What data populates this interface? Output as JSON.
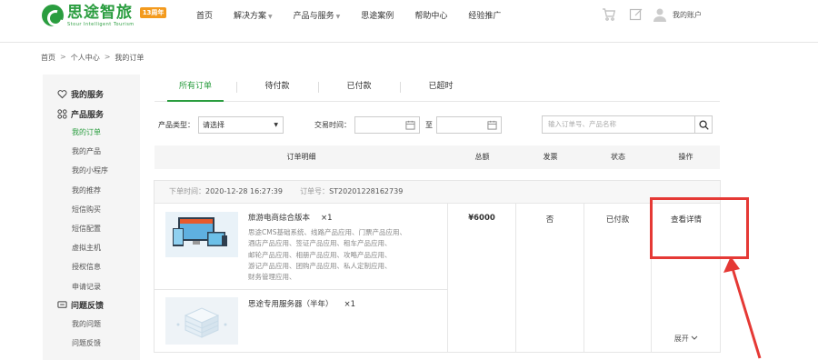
{
  "header": {
    "logo_cn": "思途智旅",
    "logo_en": "Stour  Intelligent  Tourism",
    "logo_badge": "13周年",
    "nav": [
      {
        "label": "首页"
      },
      {
        "label": "解决方案",
        "caret": "▼"
      },
      {
        "label": "产品与服务",
        "caret": "▼"
      },
      {
        "label": "思途案例"
      },
      {
        "label": "帮助中心"
      },
      {
        "label": "经验推广"
      }
    ],
    "icons": [
      "cart-icon",
      "edit-icon",
      "user-icon"
    ],
    "account_label": "我的账户"
  },
  "breadcrumb": [
    "首页",
    "个人中心",
    "我的订单"
  ],
  "breadcrumb_sep": ">",
  "sidebar": {
    "groups": [
      {
        "label": "我的服务",
        "icon": "heart-icon",
        "items": []
      },
      {
        "label": "产品服务",
        "icon": "grid-icon",
        "items": [
          "我的订单",
          "我的产品",
          "我的小程序",
          "我的推荐",
          "短信购买",
          "短信配置",
          "虚拟主机",
          "授权信息",
          "申请记录"
        ]
      },
      {
        "label": "问题反馈",
        "icon": "message-icon",
        "items": [
          "我的问题",
          "问题反馈"
        ]
      }
    ],
    "active_item": "我的订单"
  },
  "tabs": [
    "所有订单",
    "待付款",
    "已付款",
    "已超时"
  ],
  "active_tab": "所有订单",
  "filter": {
    "type_label": "产品类型：",
    "type_value": "请选择",
    "time_label": "交易时间：",
    "to_label": "至",
    "search_placeholder": "输入订单号、产品名称"
  },
  "table_headers": [
    "订单明细",
    "总额",
    "发票",
    "状态",
    "操作"
  ],
  "order": {
    "time_label": "下单时间：",
    "time_value": "2020-12-28 16:27:39",
    "no_label": "订单号：",
    "no_value": "ST20201228162739",
    "products": [
      {
        "name": "旅游电商综合版本",
        "qty": "×1",
        "desc": [
          "思途CMS基础系统、线路产品应用、门票产品应用、",
          "酒店产品应用、签证产品应用、租车产品应用、",
          "邮轮产品应用、相册产品应用、攻略产品应用、",
          "游记产品应用、团购产品应用、私人定制应用、",
          "财务管理应用、"
        ]
      },
      {
        "name": "思途专用服务器（半年）",
        "qty": "×1",
        "desc": []
      }
    ],
    "total": "¥6000",
    "invoice": "否",
    "status": "已付款",
    "op_detail": "查看详情",
    "op_expand": "展开"
  },
  "colors": {
    "brand_green": "#2a9d3f",
    "badge_orange": "#f39a1d",
    "annotation_red": "#e53935"
  }
}
